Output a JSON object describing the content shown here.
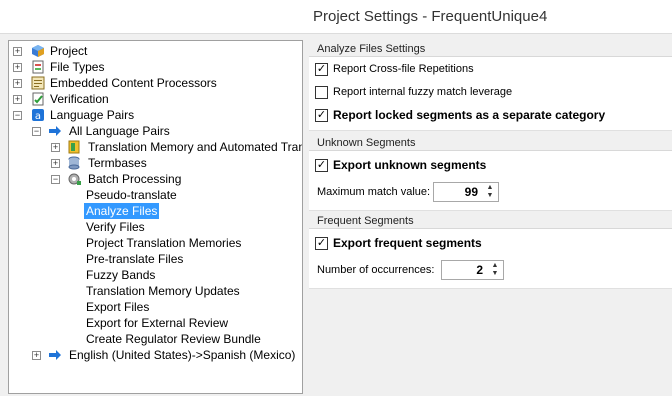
{
  "window": {
    "title": "Project Settings - FrequentUnique4"
  },
  "tree": {
    "items": [
      {
        "label": "Project",
        "expander": "+",
        "icon": "project-icon"
      },
      {
        "label": "File Types",
        "expander": "+",
        "icon": "file-types-icon"
      },
      {
        "label": "Embedded Content Processors",
        "expander": "+",
        "icon": "embedded-content-icon"
      },
      {
        "label": "Verification",
        "expander": "+",
        "icon": "verification-icon"
      },
      {
        "label": "Language Pairs",
        "expander": "−",
        "icon": "language-pairs-icon"
      },
      {
        "label": "All Language Pairs",
        "expander": "−",
        "icon": "arrow-right-icon"
      },
      {
        "label": "Translation Memory and Automated Tran",
        "expander": "+",
        "icon": "tm-icon"
      },
      {
        "label": "Termbases",
        "expander": "+",
        "icon": "termbase-icon"
      },
      {
        "label": "Batch Processing",
        "expander": "−",
        "icon": "batch-gear-icon"
      },
      {
        "label": "Pseudo-translate"
      },
      {
        "label": "Analyze Files",
        "selected": true
      },
      {
        "label": "Verify Files"
      },
      {
        "label": "Project Translation Memories"
      },
      {
        "label": "Pre-translate Files"
      },
      {
        "label": "Fuzzy Bands"
      },
      {
        "label": "Translation Memory Updates"
      },
      {
        "label": "Export Files"
      },
      {
        "label": "Export for External Review"
      },
      {
        "label": "Create Regulator Review Bundle"
      },
      {
        "label": "English (United States)->Spanish (Mexico)",
        "expander": "+",
        "icon": "arrow-right-icon"
      }
    ]
  },
  "analyze": {
    "header": "Analyze Files Settings",
    "options": [
      {
        "label": "Report Cross-file Repetitions",
        "checked": true,
        "bold": false
      },
      {
        "label": "Report internal fuzzy match leverage",
        "checked": false,
        "bold": false
      },
      {
        "label": "Report locked segments as a separate category",
        "checked": true,
        "bold": true
      }
    ]
  },
  "unknown": {
    "header": "Unknown Segments",
    "export_label": "Export unknown segments",
    "export_checked": true,
    "max_match_label": "Maximum match value:",
    "max_match_value": "99"
  },
  "frequent": {
    "header": "Frequent Segments",
    "export_label": "Export frequent segments",
    "export_checked": true,
    "occurrences_label": "Number of occurrences:",
    "occurrences_value": "2"
  },
  "colors": {
    "selection": "#3399ff",
    "arrow": "#1e73d8"
  }
}
